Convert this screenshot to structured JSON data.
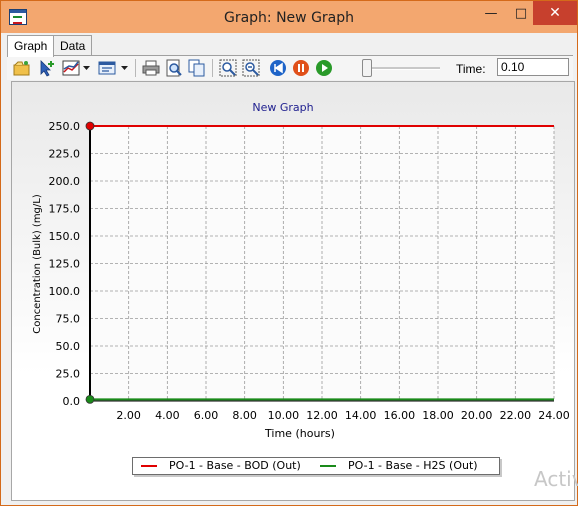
{
  "window": {
    "title": "Graph: New Graph",
    "min_symbol": "—",
    "max_symbol": "□",
    "close_symbol": "✕"
  },
  "tabs": [
    {
      "label": "Graph",
      "active": true
    },
    {
      "label": "Data",
      "active": false
    }
  ],
  "toolbar": {
    "icons": [
      "open-graph-icon",
      "add-series-icon",
      "graph-options-icon",
      "dropdown-icon",
      "view-options-icon",
      "dropdown-icon",
      "print-icon",
      "print-preview-icon",
      "copy-icon",
      "zoom-in-icon",
      "zoom-out-icon",
      "rewind-icon",
      "pause-icon",
      "play-icon"
    ],
    "time_label": "Time:",
    "time_value": "0.10",
    "slider_position": 0.0
  },
  "chart_data": {
    "type": "line",
    "title": "New Graph",
    "xlabel": "Time (hours)",
    "ylabel": "Concentration (Bulk)  (mg/L)",
    "xlim": [
      0,
      24
    ],
    "ylim": [
      0,
      250
    ],
    "x_ticks": [
      "2.00",
      "4.00",
      "6.00",
      "8.00",
      "10.00",
      "12.00",
      "14.00",
      "16.00",
      "18.00",
      "20.00",
      "22.00",
      "24.00"
    ],
    "y_ticks": [
      "250.0",
      "225.0",
      "200.0",
      "175.0",
      "150.0",
      "125.0",
      "100.0",
      "75.0",
      "50.0",
      "25.0",
      "0.0"
    ],
    "grid": true,
    "legend_position": "bottom",
    "series": [
      {
        "name": "PO-1 - Base - BOD (Out)",
        "color": "#e00000",
        "x": [
          0,
          24
        ],
        "y": [
          250,
          250
        ]
      },
      {
        "name": "PO-1 - Base - H2S (Out)",
        "color": "#1a8a1a",
        "x": [
          0,
          24
        ],
        "y": [
          1.5,
          1.5
        ]
      }
    ]
  },
  "watermark": "Activ"
}
